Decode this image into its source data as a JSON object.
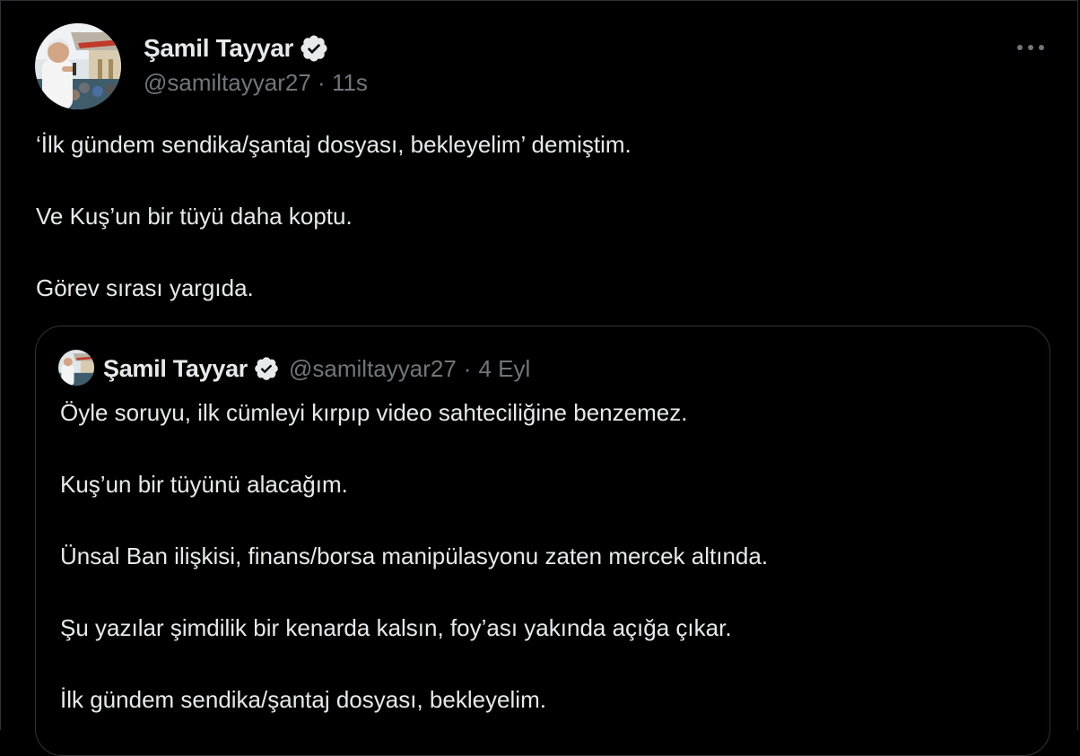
{
  "tweet": {
    "author_name": "Şamil Tayyar",
    "handle": "@samiltayyar27",
    "separator": "·",
    "time": "11s",
    "paragraphs": [
      "‘İlk gündem sendika/şantaj dosyası, bekleyelim’ demiştim.",
      "Ve Kuş’un bir tüyü daha koptu.",
      "Görev sırası yargıda."
    ],
    "icons": {
      "verified": "verified-badge-icon",
      "more": "more-options-icon"
    }
  },
  "quote": {
    "author_name": "Şamil Tayyar",
    "handle": "@samiltayyar27",
    "separator": "·",
    "time": "4 Eyl",
    "paragraphs": [
      "Öyle soruyu, ilk cümleyi kırpıp video sahteciliğine benzemez.",
      "Kuş’un bir tüyünü alacağım.",
      "Ünsal Ban ilişkisi, finans/borsa manipülasyonu zaten mercek altında.",
      "Şu yazılar şimdilik bir kenarda kalsın, foy’ası yakında açığa çıkar.",
      "İlk gündem sendika/şantaj dosyası, bekleyelim."
    ]
  },
  "colors": {
    "background": "#000000",
    "text": "#e7e9ea",
    "secondary_text": "#71767b",
    "border": "#2f3336"
  }
}
